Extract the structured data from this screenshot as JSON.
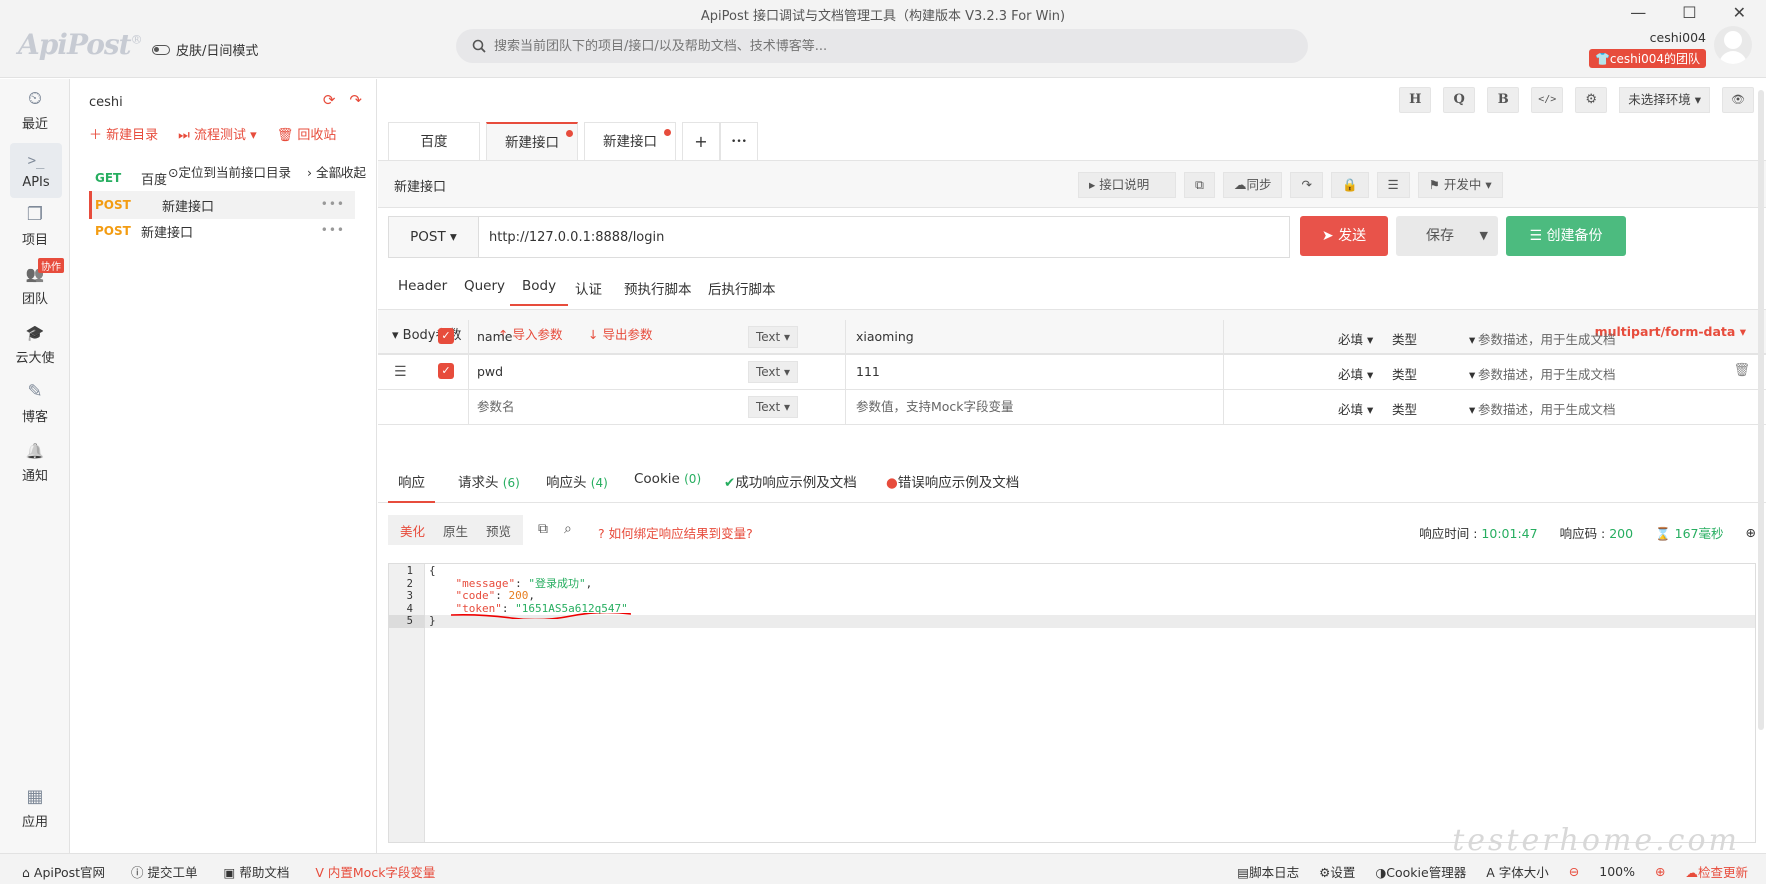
{
  "window": {
    "title": "ApiPost 接口调试与文档管理工具（构建版本 V3.2.3 For Win)",
    "controls": [
      "—",
      "☐",
      "✕"
    ]
  },
  "header": {
    "logo": "ApiPost",
    "logo_mark": "®",
    "skin_mode": "皮肤/日间模式",
    "search_placeholder": "搜索当前团队下的项目/接口/以及帮助文档、技术博客等...",
    "username": "ceshi004",
    "team": "ceshi004的团队"
  },
  "leftnav": {
    "items": [
      {
        "label": "最近",
        "icon": "clock-icon",
        "glyph": "⏲"
      },
      {
        "label": "APIs",
        "icon": "terminal-icon",
        "glyph": ">_"
      },
      {
        "label": "项目",
        "icon": "project-icon",
        "glyph": "❐"
      },
      {
        "label": "团队",
        "icon": "team-icon",
        "glyph": "👥",
        "badge": "协作"
      },
      {
        "label": "云大使",
        "icon": "graduation-cap-icon",
        "glyph": "🎓"
      },
      {
        "label": "博客",
        "icon": "edit-icon",
        "glyph": "✎"
      },
      {
        "label": "通知",
        "icon": "bell-icon",
        "glyph": "🔔"
      }
    ],
    "bottom": {
      "label": "应用",
      "icon": "apps-grid-icon",
      "glyph": "▦"
    }
  },
  "tree": {
    "project": "ceshi",
    "actions": {
      "new_dir": "新建目录",
      "flow_test": "流程测试",
      "recycle": "回收站"
    },
    "locate": "定位到当前接口目录",
    "collapse_all": "全部收起",
    "apis": [
      {
        "method": "GET",
        "name": "百度"
      },
      {
        "method": "POST",
        "name": "新建接口"
      },
      {
        "method": "POST",
        "name": "新建接口"
      }
    ],
    "more": "•••"
  },
  "toolbar": {
    "h": "H",
    "q": "Q",
    "b": "B",
    "code": "</>",
    "sliders": "⚙",
    "env": "未选择环境",
    "eye": "👁"
  },
  "tabs": [
    {
      "label": "百度",
      "dot": false
    },
    {
      "label": "新建接口",
      "dot": true
    },
    {
      "label": "新建接口",
      "dot": true
    }
  ],
  "tab_add": "+",
  "tab_more": "•••",
  "subbar": {
    "api_name": "新建接口",
    "doc": "接口说明",
    "sync": "同步",
    "status": "开发中"
  },
  "request": {
    "method": "POST",
    "url": "http://127.0.0.1:8888/login",
    "send": "发送",
    "save": "保存",
    "backup": "创建备份"
  },
  "req_tabs": [
    "Header",
    "Query",
    "Body",
    "认证",
    "预执行脚本",
    "后执行脚本"
  ],
  "body": {
    "title": "Body参数",
    "import": "导入参数",
    "export": "导出参数",
    "content_type": "multipart/form-data",
    "rows": [
      {
        "key": "name",
        "type": "Text",
        "value": "xiaoming",
        "required": "必填",
        "ptype": "类型",
        "desc": "参数描述，用于生成文档"
      },
      {
        "key": "pwd",
        "type": "Text",
        "value": "111",
        "required": "必填",
        "ptype": "类型",
        "desc": "参数描述，用于生成文档"
      },
      {
        "key": "参数名",
        "type": "Text",
        "value": "参数值，支持Mock字段变量",
        "required": "必填",
        "ptype": "类型",
        "desc": "参数描述，用于生成文档"
      }
    ]
  },
  "resp_tabs": {
    "resp": "响应",
    "req_headers": "请求头",
    "req_headers_count": "(6)",
    "resp_headers": "响应头",
    "resp_headers_count": "(4)",
    "cookie": "Cookie",
    "cookie_count": "(0)",
    "success_example": "成功响应示例及文档",
    "error_example": "错误响应示例及文档"
  },
  "response": {
    "modes": [
      "美化",
      "原生",
      "预览"
    ],
    "bind_hint": "如何绑定响应结果到变量?",
    "time_label": "响应时间 :",
    "time": "10:01:47",
    "code_label": "响应码 :",
    "code": "200",
    "duration": "167毫秒",
    "lines": [
      "1",
      "2",
      "3",
      "4",
      "5"
    ],
    "json": {
      "open": "{",
      "message_key": "\"message\"",
      "message_val": "\"登录成功\"",
      "code_key": "\"code\"",
      "code_val": "200",
      "token_key": "\"token\"",
      "token_val": "\"1651AS5a612q547\"",
      "close": "}"
    }
  },
  "statusbar": {
    "official": "ApiPost官网",
    "ticket": "提交工单",
    "help": "帮助文档",
    "mock": "内置Mock字段变量",
    "script_log": "脚本日志",
    "settings": "设置",
    "cookie_mgr": "Cookie管理器",
    "font_size": "字体大小",
    "zoom": "100%",
    "check_update": "检查更新"
  },
  "watermark": "testerhome.com",
  "colors": {
    "accent": "#e74c3c",
    "green": "#27ae60",
    "post": "#f39c12"
  }
}
